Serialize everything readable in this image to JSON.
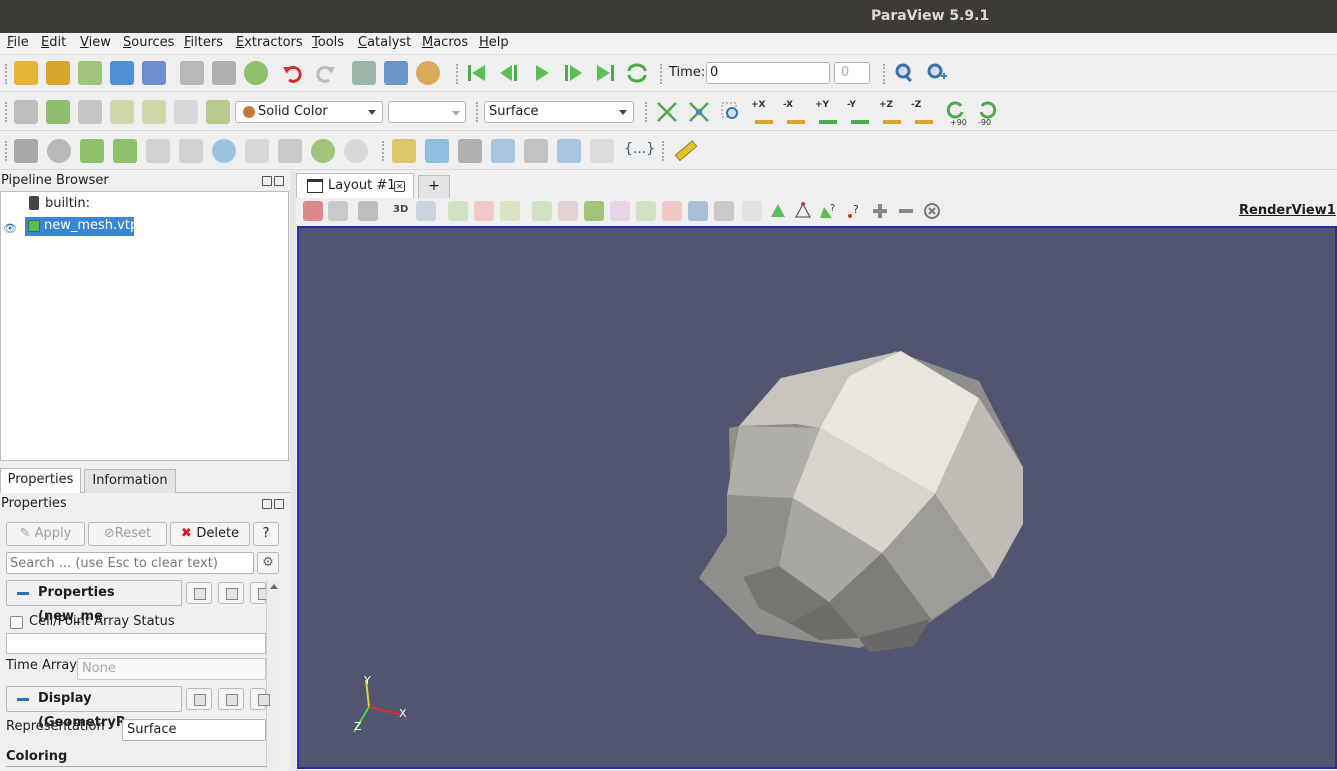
{
  "window": {
    "title": "ParaView 5.9.1"
  },
  "menu": [
    "File",
    "Edit",
    "View",
    "Sources",
    "Filters",
    "Extractors",
    "Tools",
    "Catalyst",
    "Macros",
    "Help"
  ],
  "toolbar1": {
    "time_label": "Time:",
    "time_value": "0",
    "time_step": "0"
  },
  "toolbar2": {
    "color_by": "Solid Color",
    "component": "",
    "representation": "Surface",
    "rot_plus": "+90",
    "rot_minus": "-90",
    "axes": {
      "px": "+X",
      "mx": "-X",
      "py": "+Y",
      "my": "-Y",
      "pz": "+Z",
      "mz": "-Z"
    }
  },
  "toolbar3": {
    "braces": "{...}"
  },
  "pipeline": {
    "title": "Pipeline Browser",
    "items": [
      {
        "label": "builtin:"
      },
      {
        "label": "new_mesh.vtp"
      }
    ]
  },
  "prop_tabs": [
    {
      "label": "Properties"
    },
    {
      "label": "Information"
    }
  ],
  "properties": {
    "title": "Properties",
    "apply": "Apply",
    "reset": "Reset",
    "delete": "Delete",
    "help": "?",
    "search_placeholder": "Search ... (use Esc to clear text)",
    "section1": "Properties (new_me",
    "cell_point": "Cell/Point Array Status",
    "time_array_label": "Time Array",
    "time_array_value": "None",
    "section2": "Display (GeometryR",
    "representation_label": "Representation",
    "representation_value": "Surface",
    "coloring": "Coloring"
  },
  "layout": {
    "tab": "Layout #1",
    "add": "+",
    "view_name": "RenderView1",
    "mode_3d": "3D"
  },
  "render": {
    "background": "#525570",
    "axes": {
      "x": "X",
      "y": "Y",
      "z": "Z"
    }
  },
  "colors": {
    "titlebar": "#3c3b37",
    "selection": "#3a86d4",
    "accent": "#2e6fb7"
  }
}
